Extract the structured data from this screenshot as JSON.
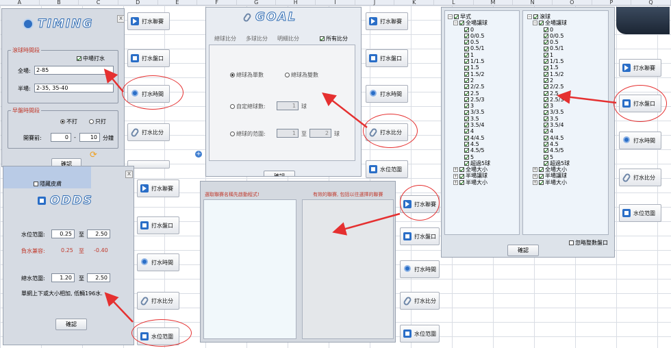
{
  "columns": [
    "A",
    "B",
    "C",
    "D",
    "E",
    "F",
    "G",
    "H",
    "I",
    "J",
    "K",
    "L",
    "M",
    "N",
    "O",
    "P",
    "Q"
  ],
  "side_buttons": {
    "league": "打水聯賽",
    "handicap": "打水盤口",
    "time": "打水時間",
    "ratio": "打水比分",
    "range": "水位范圍"
  },
  "timing": {
    "logo": "TIMING",
    "close": "x",
    "live_group": "滾球時間段",
    "halftime_check": "中場打水",
    "full_label": "全場:",
    "full_value": "2-85",
    "half_label": "半場:",
    "half_value": "2-35, 35-40",
    "early_group": "早盤時間段",
    "no_bet": "不打",
    "only_bet": "只打",
    "before_label": "開賽前:",
    "before_from": "0",
    "dash": "-",
    "before_to": "10",
    "minute": "分鐘",
    "ok": "確認",
    "hidden_label": "隱藏皮膚"
  },
  "goal": {
    "logo": "GOAL",
    "tabs": [
      "總球比分",
      "多球比分",
      "明細比分"
    ],
    "all_check": "所有比分",
    "odd": "總球為單數",
    "even": "總球為雙數",
    "custom": "自定總球數:",
    "custom_val": "1",
    "ball": "球",
    "range": "總球的范圍:",
    "range_from": "1",
    "to": "至",
    "range_to": "2",
    "ok": "確認"
  },
  "odds": {
    "logo": "ODDS",
    "close": "x",
    "water_label": "水位范圍:",
    "water_from": "0.25",
    "to": "至",
    "water_to": "2.50",
    "neg_label": "負水兼容:",
    "neg_from": "0.25",
    "neg_to": "-0.40",
    "total_label": "總水范圍:",
    "total_from": "1.20",
    "total_to": "2.50",
    "note": "單網上下或大小相加, 低輛196水.",
    "ok": "確認"
  },
  "league": {
    "left_title": "選取聯賽名稱先啟動程式!",
    "right_title": "有效的聯賽, 包括以往選擇的聯賽"
  },
  "tree_left": {
    "root": "早式",
    "sub": "全場讓球",
    "items": [
      "0",
      "0/0.5",
      "0.5",
      "0.5/1",
      "1",
      "1/1.5",
      "1.5",
      "1.5/2",
      "2",
      "2/2.5",
      "2.5",
      "2.5/3",
      "3",
      "3/3.5",
      "3.5",
      "3.5/4",
      "4",
      "4/4.5",
      "4.5",
      "4.5/5",
      "5",
      "超過5球"
    ],
    "others": [
      "全場大小",
      "半場讓球",
      "半場大小"
    ]
  },
  "tree_right": {
    "root": "滾球",
    "sub": "全場讓球",
    "items": [
      "0",
      "0/0.5",
      "0.5",
      "0.5/1",
      "1",
      "1/1.5",
      "1.5",
      "1.5/2",
      "2",
      "2/2.5",
      "2.5",
      "2.5/3",
      "3",
      "3/3.5",
      "3.5",
      "3.5/4",
      "4",
      "4/4.5",
      "4.5",
      "4.5/5",
      "5",
      "超過5球"
    ],
    "others": [
      "全場大小",
      "半場讓球",
      "半場大小"
    ]
  },
  "handicap": {
    "ok": "確認",
    "ignore": "忽略整數盤口"
  },
  "colors": {
    "accent": "#2a6ec7",
    "annotation": "#e53030",
    "group_title": "#c0392b"
  }
}
